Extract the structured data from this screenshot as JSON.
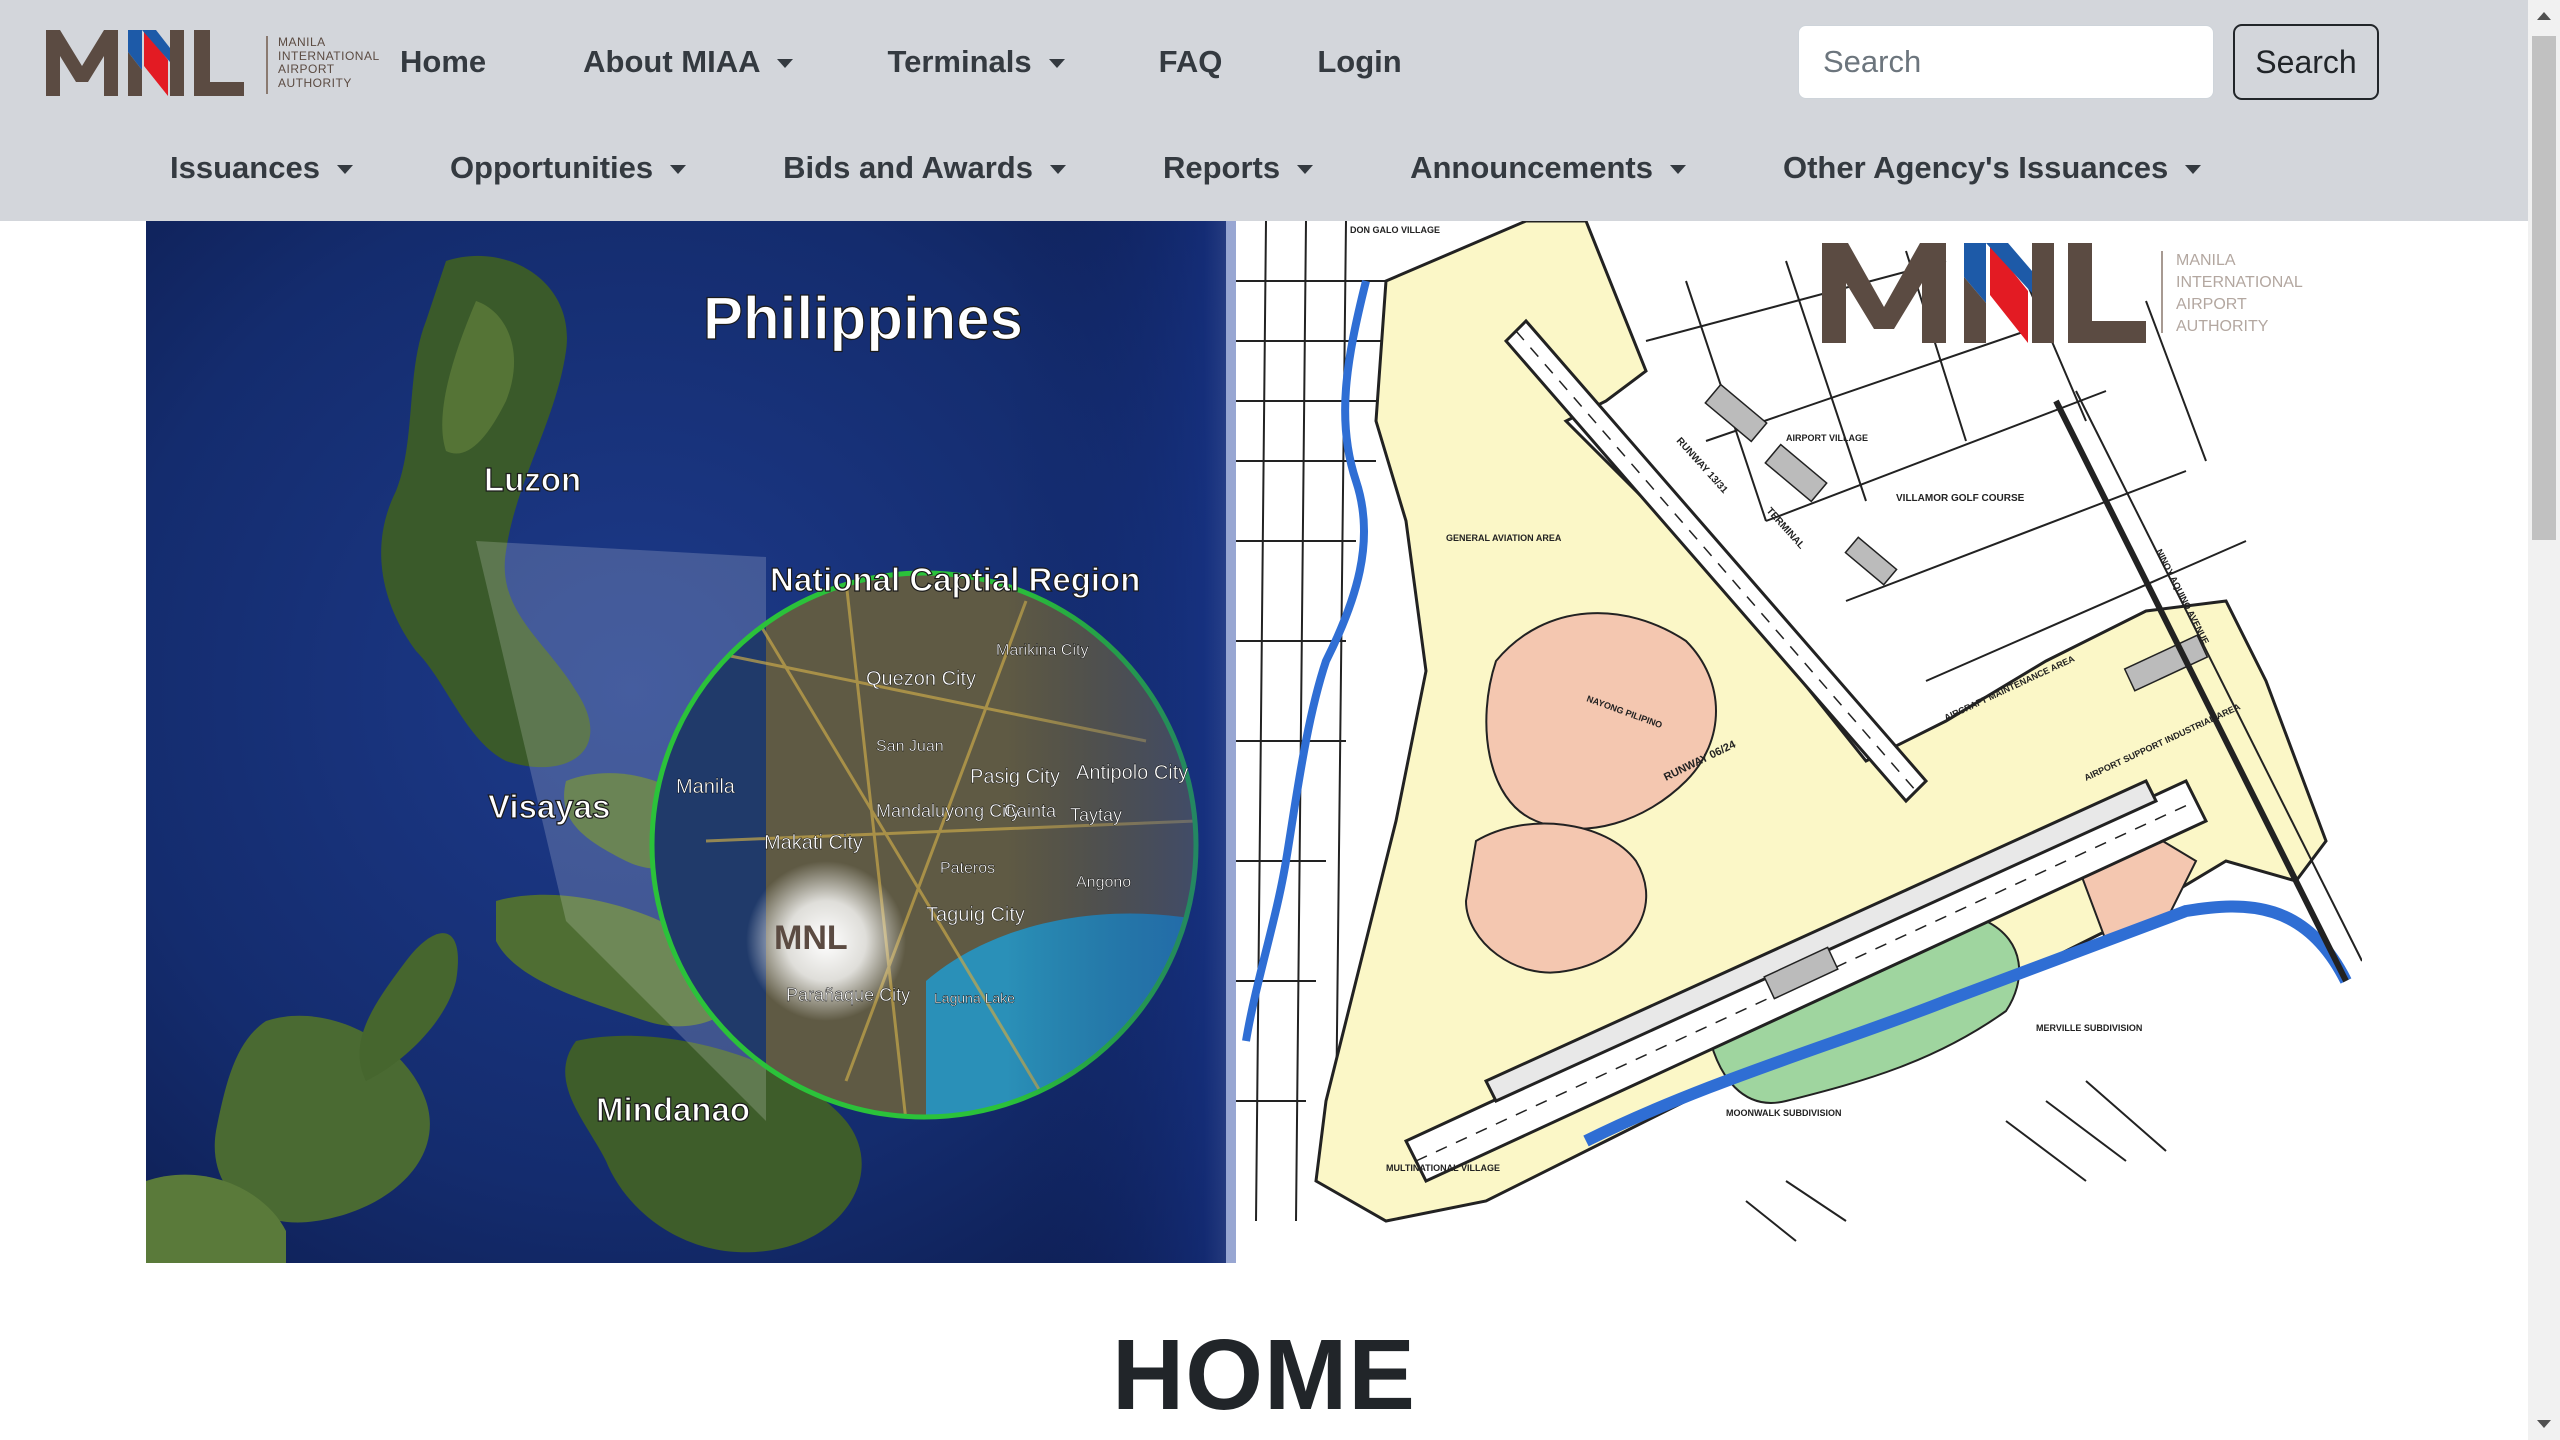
{
  "logo": {
    "letters": "MNL",
    "org_lines": [
      "MANILA",
      "INTERNATIONAL",
      "AIRPORT",
      "AUTHORITY"
    ]
  },
  "nav_primary": {
    "home": "Home",
    "about": "About MIAA",
    "terminals": "Terminals",
    "faq": "FAQ",
    "login": "Login"
  },
  "search": {
    "placeholder": "Search",
    "button_label": "Search"
  },
  "nav_secondary": {
    "issuances": "Issuances",
    "opportunities": "Opportunities",
    "bids": "Bids and Awards",
    "reports": "Reports",
    "announcements": "Announcements",
    "other_agency": "Other Agency's Issuances"
  },
  "banner": {
    "title": "Philippines",
    "region_label": "National Captial Region",
    "islands": {
      "luzon": "Luzon",
      "visayas": "Visayas",
      "mindanao": "Mindanao"
    },
    "cities": {
      "manila": "Manila",
      "quezon": "Quezon City",
      "marikina": "Marikina City",
      "san_juan": "San Juan",
      "pasig": "Pasig City",
      "antipolo": "Antipolo City",
      "mandaluyong": "Mandaluyong City",
      "cainta": "Cainta",
      "taytay": "Taytay",
      "makati": "Makati City",
      "pateros": "Pateros",
      "taguig": "Taguig City",
      "angono": "Angono",
      "paranaque": "Parañaque City",
      "laguna": "Laguna Lake"
    },
    "map_logo": "MNL",
    "map_logo_lines": [
      "MANILA",
      "INTERNATIONAL",
      "AIRPORT",
      "AUTHORITY"
    ],
    "map_labels": {
      "runway_main": "RUNWAY 06/24",
      "runway_cross": "RUNWAY 13/31",
      "terminal": "TERMINAL",
      "general_aviation": "GENERAL AVIATION AREA",
      "villamor": "VILLAMOR GOLF COURSE",
      "nayong": "NAYONG PILIPINO",
      "airport_village": "AIRPORT VILLAGE",
      "merville": "MERVILLE SUBDIVISION",
      "moonwalk": "MOONWALK SUBDIVISION",
      "multinational": "MULTINATIONAL VILLAGE",
      "aircraft_maintenance": "AIRCRAFT MAINTENANCE AREA",
      "airport_support": "AIRPORT SUPPORT INDUSTRIAL AREA",
      "don_galo": "DON GALO VILLAGE",
      "ninoy": "NINOY AQUINO AVENUE"
    }
  },
  "page_title": "HOME",
  "colors": {
    "navbar_bg": "#d3d6db",
    "logo_brown": "#5b4b42",
    "logo_red": "#e31b23",
    "logo_blue": "#1d5aa8",
    "nav_text": "#343a40",
    "title_text": "#212529",
    "map_yellow": "#fbf7c7",
    "map_pink": "#f4c7b0",
    "map_green": "#9fd59f",
    "map_water": "#2f6ed4",
    "ncr_circle": "#2bc23a"
  }
}
